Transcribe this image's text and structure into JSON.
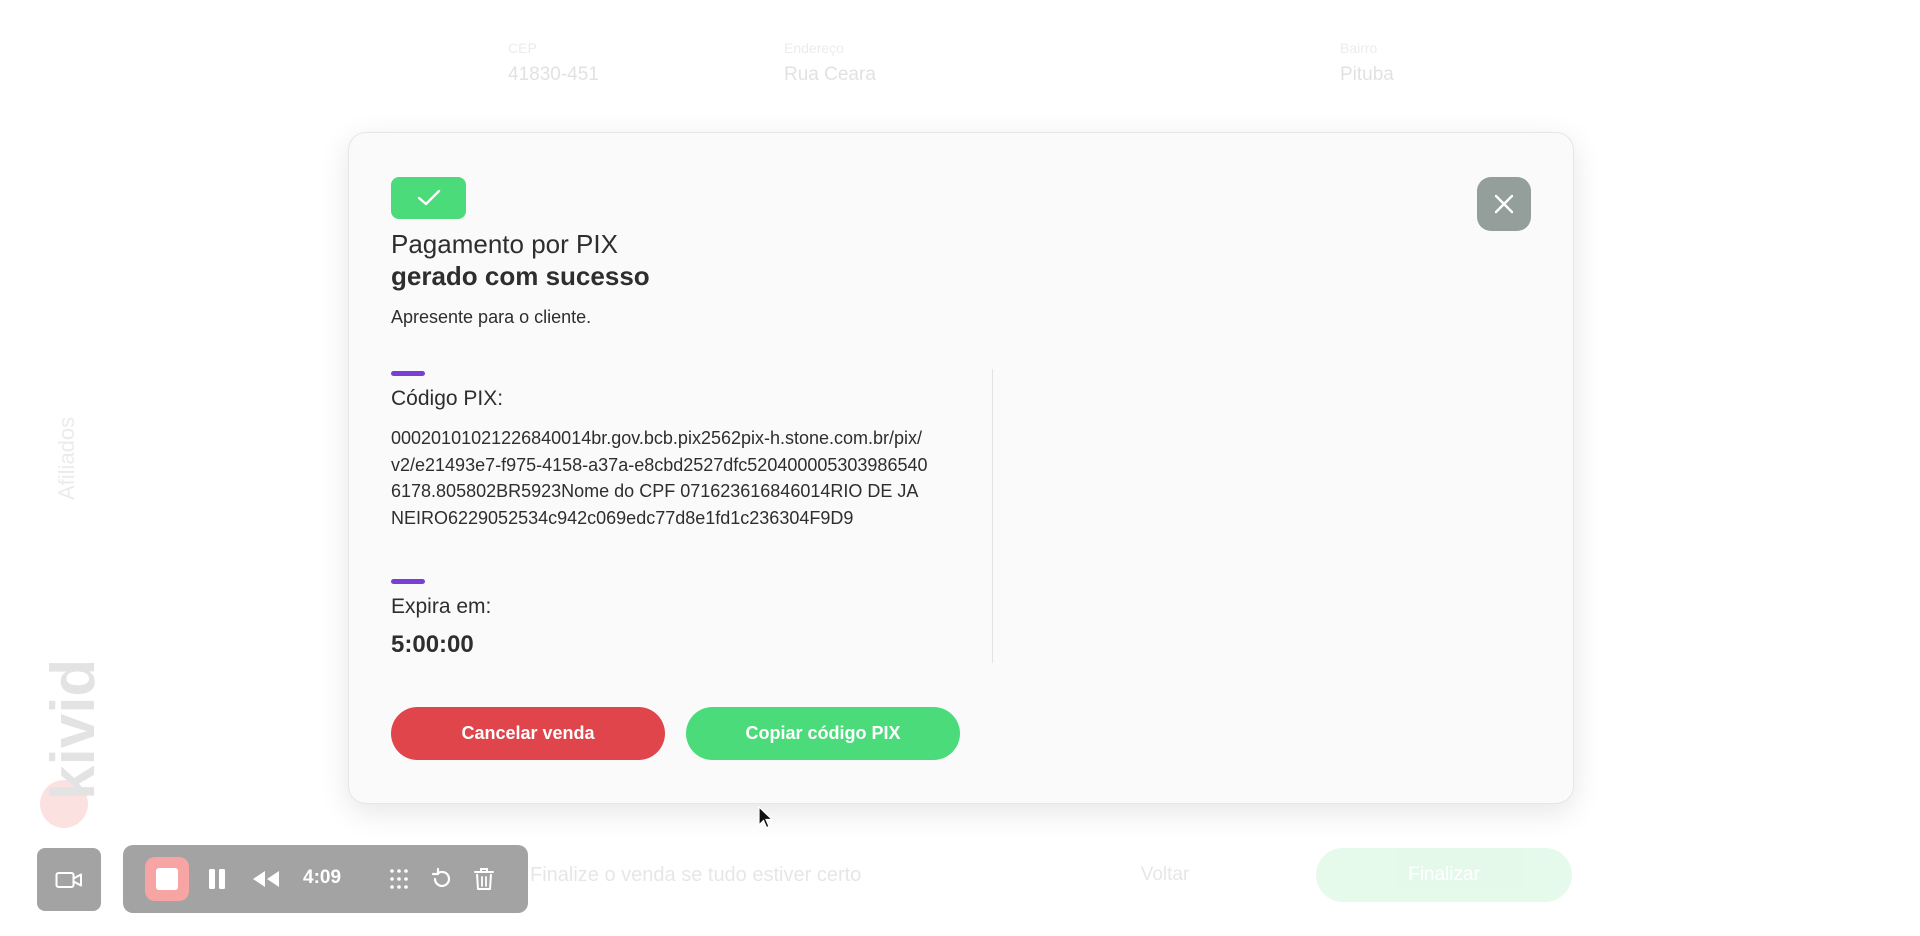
{
  "background": {
    "fields": [
      {
        "label": "CEP",
        "value": "41830-451"
      },
      {
        "label": "Endereço",
        "value": "Rua Ceara"
      },
      {
        "label": "Bairro",
        "value": "Pituba"
      }
    ],
    "sidebar_label": "Afiliados",
    "logo_text": "kivid",
    "footer_text": "Finalize o venda se tudo estiver certo",
    "back_label": "Voltar",
    "finish_label": "Finalizar"
  },
  "modal": {
    "title_line1": "Pagamento por PIX",
    "title_line2": "gerado com sucesso",
    "subtitle": "Apresente para o cliente.",
    "pix_label": "Código PIX:",
    "pix_code": "00020101021226840014br.gov.bcb.pix2562pix-h.stone.com.br/pix/v2/e21493e7-f975-4158-a37a-e8cbd2527dfc5204000053039865406178.805802BR5923Nome do CPF 071623616846014RIO DE JANEIRO6229052534c942c069edc77d8e1fd1c236304F9D9",
    "expires_label": "Expira em:",
    "expires_value": "5:00:00",
    "cancel_label": "Cancelar venda",
    "copy_label": "Copiar código PIX"
  },
  "recorder": {
    "time": "4:09"
  },
  "colors": {
    "success": "#4cdb7a",
    "danger": "#e0454b",
    "accent": "#7a3fd6",
    "close_button": "#949e9a"
  },
  "icons": [
    "checkmark-icon",
    "close-icon",
    "video-camera-icon",
    "stop-icon",
    "pause-icon",
    "rewind-icon",
    "grid-icon",
    "restart-icon",
    "trash-icon",
    "mouse-cursor"
  ]
}
